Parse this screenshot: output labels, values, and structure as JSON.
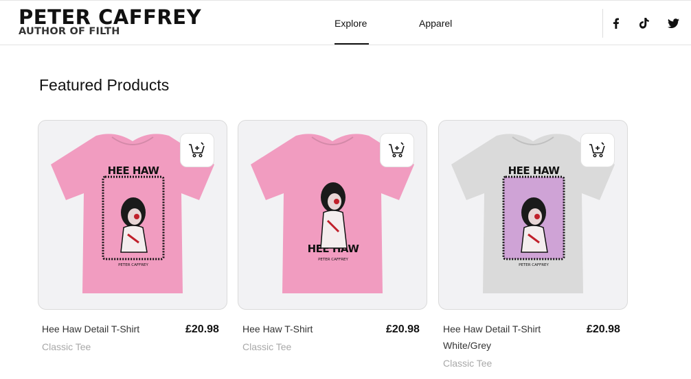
{
  "brand": {
    "title": "PETER CAFFREY",
    "subtitle": "AUTHOR OF FILTH"
  },
  "nav": {
    "items": [
      {
        "label": "Explore"
      },
      {
        "label": "Apparel"
      }
    ],
    "active": "Explore"
  },
  "social": [
    {
      "icon": "facebook-icon"
    },
    {
      "icon": "tiktok-icon"
    },
    {
      "icon": "twitter-icon"
    }
  ],
  "section": {
    "title": "Featured Products"
  },
  "products": [
    {
      "name": "Hee Haw Detail T-Shirt",
      "price": "£20.98",
      "type": "Classic Tee",
      "shirt_color": "#f19cc0",
      "print_bg": "#f19cc0",
      "print_text": "HEE HAW",
      "print_credit": "PETER CAFFREY"
    },
    {
      "name": "Hee Haw T-Shirt",
      "price": "£20.98",
      "type": "Classic Tee",
      "shirt_color": "#f19cc0",
      "print_bg": "none",
      "print_text": "HEE HAW",
      "print_credit": "PETER CAFFREY"
    },
    {
      "name": "Hee Haw Detail T-Shirt White/Grey",
      "price": "£20.98",
      "type": "Classic Tee",
      "shirt_color": "#dadada",
      "print_bg": "#cfa3d6",
      "print_text": "HEE HAW",
      "print_credit": "PETER CAFFREY"
    }
  ]
}
